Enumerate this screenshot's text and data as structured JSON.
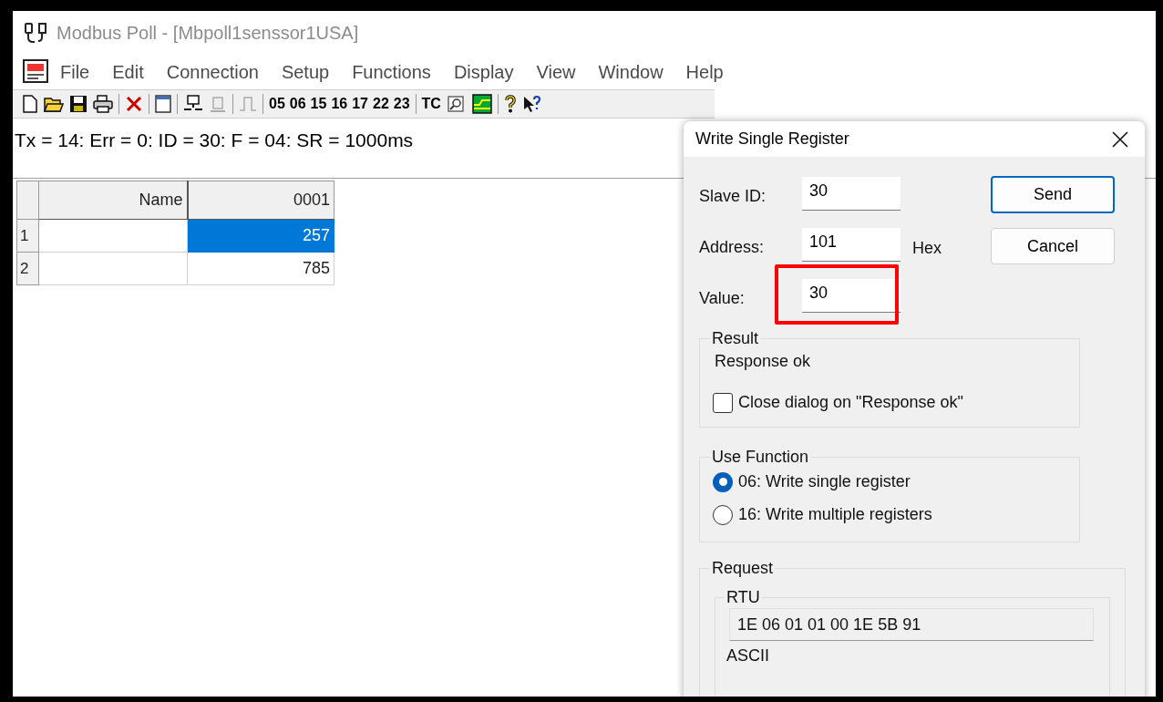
{
  "window": {
    "title": "Modbus Poll - [Mbpoll1senssor1USA]"
  },
  "menu": [
    "File",
    "Edit",
    "Connection",
    "Setup",
    "Functions",
    "Display",
    "View",
    "Window",
    "Help"
  ],
  "toolbar": {
    "function_codes": [
      "05",
      "06",
      "15",
      "16",
      "17",
      "22",
      "23"
    ],
    "tc": "TC"
  },
  "status_line": "Tx = 14: Err = 0: ID = 30: F = 04: SR = 1000ms",
  "table": {
    "columns": [
      "Name",
      "0001"
    ],
    "rows": [
      {
        "index": "1",
        "value": "257",
        "selected": true
      },
      {
        "index": "2",
        "value": "785",
        "selected": false
      }
    ]
  },
  "dialog": {
    "title": "Write Single Register",
    "fields": [
      {
        "label": "Slave ID:",
        "value": "30",
        "highlighted": false
      },
      {
        "label": "Address:",
        "value": "101",
        "suffix": "Hex",
        "highlighted": false
      },
      {
        "label": "Value:",
        "value": "30",
        "highlighted": true
      }
    ],
    "buttons": [
      {
        "label": "Send",
        "default": true
      },
      {
        "label": "Cancel",
        "default": false
      }
    ],
    "result": {
      "title": "Result",
      "text": "Response ok",
      "checkbox": {
        "label": "Close dialog on \"Response ok\"",
        "checked": false
      }
    },
    "use_function": {
      "title": "Use Function",
      "options": [
        {
          "label": "06: Write single register",
          "selected": true
        },
        {
          "label": "16: Write multiple registers",
          "selected": false
        }
      ]
    },
    "request": {
      "title": "Request",
      "rtu": {
        "title": "RTU",
        "value": "1E 06 01 01 00 1E 5B 91"
      },
      "ascii_title": "ASCII"
    }
  }
}
